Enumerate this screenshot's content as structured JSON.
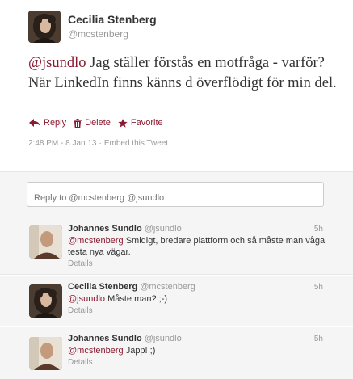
{
  "tweet": {
    "author_name": "Cecilia Stenberg",
    "author_handle": "@mcstenberg",
    "mention": "@jsundlo",
    "text_rest": " Jag ställer förstås en motfråga - varför? När LinkedIn finns känns d överflödigt för min del.",
    "actions": {
      "reply": "Reply",
      "delete": "Delete",
      "favorite": "Favorite"
    },
    "timestamp": "2:48 PM - 8 Jan 13",
    "separator": "·",
    "embed": "Embed this Tweet"
  },
  "reply_box": {
    "placeholder": "Reply to @mcstenberg @jsundlo"
  },
  "replies": [
    {
      "name": "Johannes Sundlo",
      "handle": "@jsundlo",
      "time": "5h",
      "mention": "@mcstenberg",
      "text": " Smidigt, bredare plattform och så måste man våga testa nya vägar.",
      "details": "Details"
    },
    {
      "name": "Cecilia Stenberg",
      "handle": "@mcstenberg",
      "time": "5h",
      "mention": "@jsundlo",
      "text": " Måste man? ;-)",
      "details": "Details"
    },
    {
      "name": "Johannes Sundlo",
      "handle": "@jsundlo",
      "time": "5h",
      "mention": "@mcstenberg",
      "text": " Japp! ;)",
      "details": "Details"
    }
  ],
  "icons": {
    "reply": "reply-arrow-icon",
    "delete": "trash-icon",
    "favorite": "star-icon"
  },
  "colors": {
    "link": "#8a1a30",
    "muted": "#999999",
    "reply_bg": "#f5f5f5"
  }
}
